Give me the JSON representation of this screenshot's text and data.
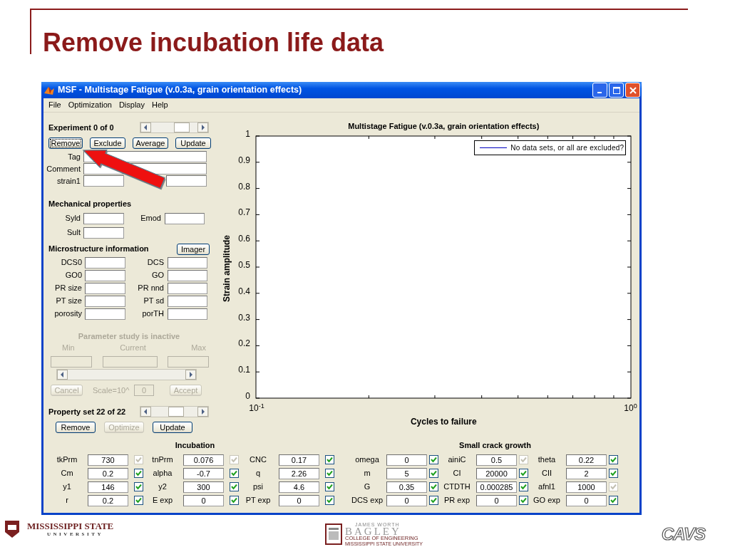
{
  "slide": {
    "title": "Remove incubation life data"
  },
  "window": {
    "title": "MSF - Multistage Fatigue (v.0.3a, grain orientation effects)"
  },
  "menu": [
    "File",
    "Optimization",
    "Display",
    "Help"
  ],
  "experiment": {
    "label": "Experiment 0 of 0",
    "buttons": [
      {
        "label": "Remove",
        "focused": true
      },
      {
        "label": "Exclude",
        "focused": false
      },
      {
        "label": "Average",
        "focused": false
      },
      {
        "label": "Update",
        "focused": false
      }
    ],
    "fields": [
      {
        "label": "Tag",
        "kind": "wide"
      },
      {
        "label": "Comment",
        "kind": "wide"
      },
      {
        "label": "strain1",
        "kind": "pair"
      }
    ]
  },
  "mechanical": {
    "title": "Mechanical properties",
    "rows": [
      {
        "left": "Syld",
        "right": "Emod"
      },
      {
        "left": "Sult"
      }
    ]
  },
  "microstructure": {
    "title": "Microstructure information",
    "button": "Imager",
    "rows": [
      {
        "left": "DCS0",
        "right": "DCS"
      },
      {
        "left": "GO0",
        "right": "GO"
      },
      {
        "left": "PR size",
        "right": "PR nnd"
      },
      {
        "left": "PT size",
        "right": "PT sd"
      },
      {
        "left": "porosity",
        "right": "porTH"
      }
    ]
  },
  "parameter_study": {
    "title": "Parameter study is inactive",
    "disabled": true,
    "columns": [
      "Min",
      "Current",
      "Max"
    ],
    "cancel": "Cancel",
    "scale_label": "Scale=10^",
    "scale_value": "0",
    "accept": "Accept"
  },
  "property_set": {
    "label": "Property set 22 of 22",
    "buttons": [
      {
        "label": "Remove",
        "disabled": false
      },
      {
        "label": "Optimize",
        "disabled": true
      },
      {
        "label": "Update",
        "disabled": false
      }
    ]
  },
  "chart": {
    "chart_data": {
      "type": "line",
      "title": "Multistage Fatigue (v.0.3a, grain orientation effects)",
      "xlabel": "Cycles to failure",
      "ylabel": "Strain amplitude",
      "xlim": [
        0.1,
        1
      ],
      "ylim": [
        0,
        1
      ],
      "xticks": [
        {
          "value": 0.1,
          "label": "10$^{-1}$"
        },
        {
          "value": 1,
          "label": "10$^{0}$"
        }
      ],
      "yticks": [
        0,
        0.1,
        0.2,
        0.3,
        0.4,
        0.5,
        0.6,
        0.7,
        0.8,
        0.9,
        1
      ]
    },
    "legend": [
      {
        "label": "No data sets, or all are excluded?",
        "color": "#0000c0"
      }
    ]
  },
  "groups": [
    {
      "title": "Incubation",
      "params": [
        {
          "label": "tkPrm",
          "value": "730",
          "checked": true,
          "disabled": true
        },
        {
          "label": "tnPrm",
          "value": "0.076",
          "checked": true,
          "disabled": true
        },
        {
          "label": "CNC",
          "value": "0.17",
          "checked": true,
          "disabled": false
        },
        {
          "label": "Cm",
          "value": "0.2",
          "checked": true,
          "disabled": false
        },
        {
          "label": "alpha",
          "value": "-0.7",
          "checked": true,
          "disabled": false
        },
        {
          "label": "q",
          "value": "2.26",
          "checked": true,
          "disabled": false
        },
        {
          "label": "y1",
          "value": "146",
          "checked": true,
          "disabled": false
        },
        {
          "label": "y2",
          "value": "300",
          "checked": true,
          "disabled": false
        },
        {
          "label": "psi",
          "value": "4.6",
          "checked": true,
          "disabled": false
        },
        {
          "label": "r",
          "value": "0.2",
          "checked": true,
          "disabled": false
        },
        {
          "label": "E exp",
          "value": "0",
          "checked": true,
          "disabled": false
        },
        {
          "label": "PT exp",
          "value": "0",
          "checked": true,
          "disabled": false
        }
      ]
    },
    {
      "title": "Small crack growth",
      "params": [
        {
          "label": "omega",
          "value": "0",
          "checked": true,
          "disabled": false
        },
        {
          "label": "ainiC",
          "value": "0.5",
          "checked": true,
          "disabled": true
        },
        {
          "label": "theta",
          "value": "0.22",
          "checked": true,
          "disabled": false
        },
        {
          "label": "m",
          "value": "5",
          "checked": true,
          "disabled": false
        },
        {
          "label": "CI",
          "value": "20000",
          "checked": true,
          "disabled": false
        },
        {
          "label": "CII",
          "value": "2",
          "checked": true,
          "disabled": false
        },
        {
          "label": "G",
          "value": "0.35",
          "checked": true,
          "disabled": false
        },
        {
          "label": "CTDTH",
          "value": "0.000285",
          "checked": true,
          "disabled": false
        },
        {
          "label": "afnl1",
          "value": "1000",
          "checked": true,
          "disabled": true
        },
        {
          "label": "DCS exp",
          "value": "0",
          "checked": true,
          "disabled": false
        },
        {
          "label": "PR exp",
          "value": "0",
          "checked": true,
          "disabled": false
        },
        {
          "label": "GO exp",
          "value": "0",
          "checked": true,
          "disabled": false
        }
      ]
    }
  ],
  "footer": {
    "left": {
      "name": "MISSISSIPPI STATE",
      "sub": "UNIVERSITY"
    },
    "center": {
      "top": "JAMES WORTH",
      "name": "BAGLEY",
      "line": "COLLEGE OF ENGINEERING",
      "sub": "MISSISSIPPI STATE UNIVERSITY"
    },
    "right": {
      "name": "CAVS"
    }
  }
}
